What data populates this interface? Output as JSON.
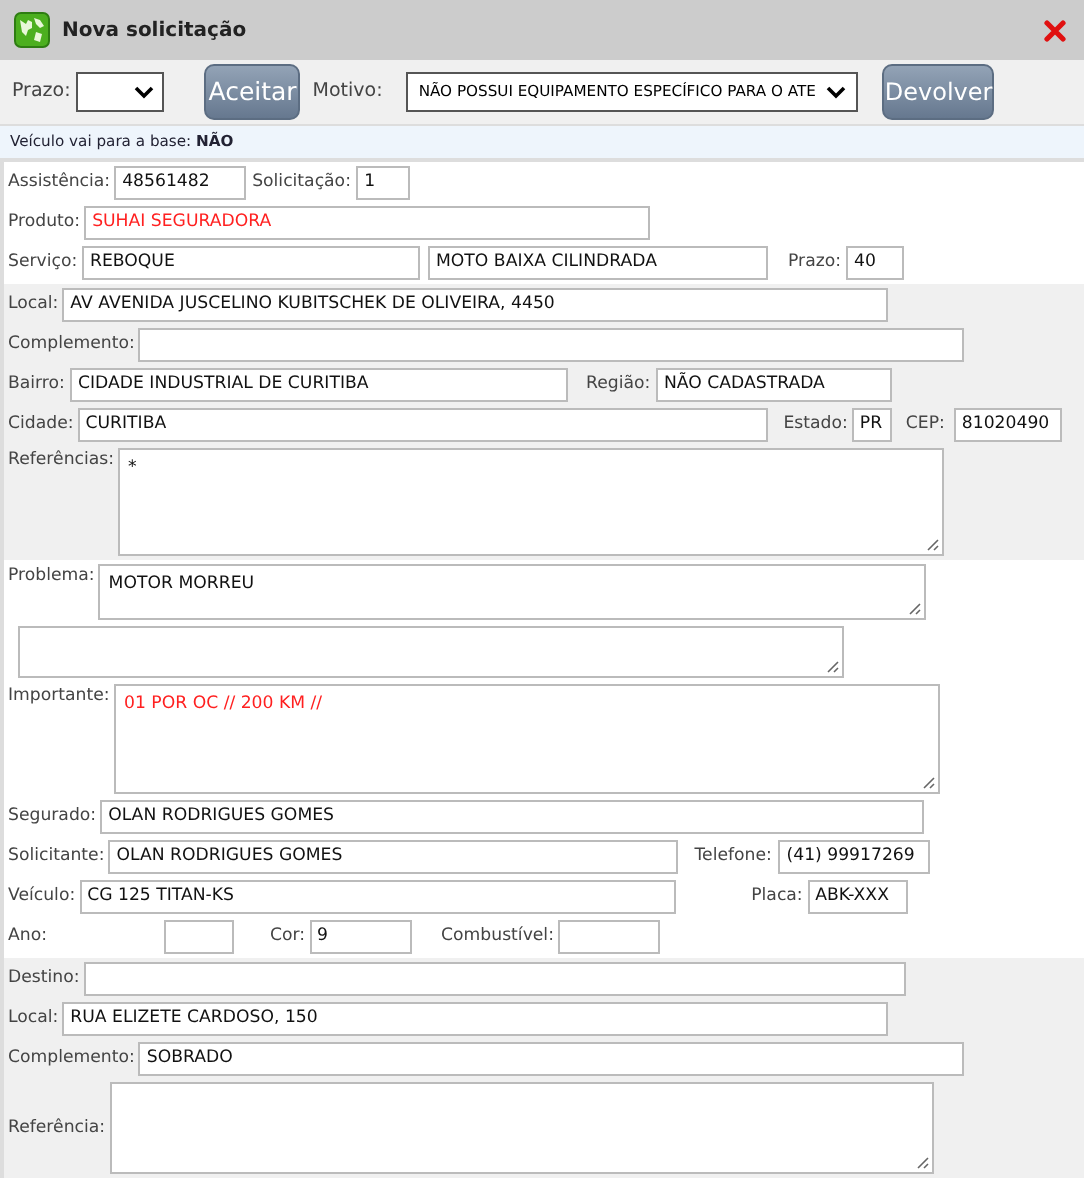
{
  "window": {
    "title": "Nova solicitação"
  },
  "toolbar": {
    "prazo_label": "Prazo:",
    "accept_button": "Aceitar",
    "motivo_label": "Motivo:",
    "motivo_value": "NÃO POSSUI EQUIPAMENTO ESPECÍFICO PARA O ATE",
    "return_button": "Devolver"
  },
  "notice": {
    "label": "Veículo vai para a base:",
    "value": "NÃO"
  },
  "sections": [
    {
      "lines": [
        {
          "fields": [
            {
              "kind": "input",
              "label": "Assistência:",
              "value": "48561482"
            },
            {
              "kind": "input",
              "label": "Solicitação:",
              "value": "1"
            }
          ]
        },
        {
          "fields": [
            {
              "kind": "input",
              "label": "Produto:",
              "value": "SUHAI SEGURADORA",
              "color": "#ff2020"
            }
          ]
        },
        {
          "fields": [
            {
              "kind": "input",
              "label": "Serviço:",
              "value": "REBOQUE"
            },
            {
              "kind": "input",
              "value": "MOTO BAIXA CILINDRADA"
            },
            {
              "kind": "input",
              "label": "Prazo:",
              "value": "40"
            }
          ]
        }
      ]
    },
    {
      "lines": [
        {
          "fields": [
            {
              "kind": "input",
              "label": "Local:",
              "value": "AV AVENIDA JUSCELINO KUBITSCHEK DE OLIVEIRA, 4450"
            }
          ]
        },
        {
          "fields": [
            {
              "kind": "input",
              "label": "Complemento:"
            }
          ]
        },
        {
          "fields": [
            {
              "kind": "input",
              "label": "Bairro:",
              "value": "CIDADE INDUSTRIAL DE CURITIBA"
            },
            {
              "kind": "input",
              "label": "Região:",
              "value": "NÃO CADASTRADA"
            }
          ]
        },
        {
          "fields": [
            {
              "kind": "input",
              "label": "Cidade:",
              "value": "CURITIBA"
            },
            {
              "kind": "input",
              "label": "Estado:",
              "value": "PR"
            },
            {
              "kind": "input",
              "label": "CEP:",
              "value": "81020490"
            }
          ]
        },
        {
          "fields": [
            {
              "kind": "textarea",
              "label": "Referências:",
              "value": "*"
            }
          ]
        }
      ]
    },
    {
      "lines": [
        {
          "fields": [
            {
              "kind": "textarea",
              "label": "Problema:",
              "value": "MOTOR MORREU"
            }
          ]
        },
        {
          "fields": [
            {
              "kind": "textarea"
            }
          ]
        },
        {
          "fields": [
            {
              "kind": "textarea",
              "label": "Importante:",
              "value": "01 POR OC // 200 KM //",
              "color": "#ff2020"
            }
          ]
        },
        {
          "fields": [
            {
              "kind": "input",
              "label": "Segurado:",
              "value": "OLAN RODRIGUES GOMES"
            }
          ]
        },
        {
          "fields": [
            {
              "kind": "input",
              "label": "Solicitante:",
              "value": "OLAN RODRIGUES GOMES"
            },
            {
              "kind": "input",
              "label": "Telefone:",
              "value": "(41) 99917269"
            }
          ]
        },
        {
          "fields": [
            {
              "kind": "input",
              "label": "Veículo:",
              "value": "CG 125 TITAN-KS"
            },
            {
              "kind": "input",
              "label": "Placa:",
              "value": "ABK-XXX"
            }
          ]
        },
        {
          "fields": [
            {
              "kind": "input",
              "label": "Ano:"
            },
            {
              "kind": "input",
              "label": "Cor:",
              "value": "9"
            },
            {
              "kind": "input",
              "label": "Combustível:"
            }
          ]
        }
      ]
    },
    {
      "lines": [
        {
          "fields": [
            {
              "kind": "input",
              "label": "Destino:"
            }
          ]
        },
        {
          "fields": [
            {
              "kind": "input",
              "label": "Local:",
              "value": "RUA ELIZETE CARDOSO, 150"
            }
          ]
        },
        {
          "fields": [
            {
              "kind": "input",
              "label": "Complemento:",
              "value": "SOBRADO"
            }
          ]
        },
        {
          "fields": [
            {
              "kind": "textarea",
              "label": "Referência:"
            }
          ]
        }
      ]
    }
  ]
}
